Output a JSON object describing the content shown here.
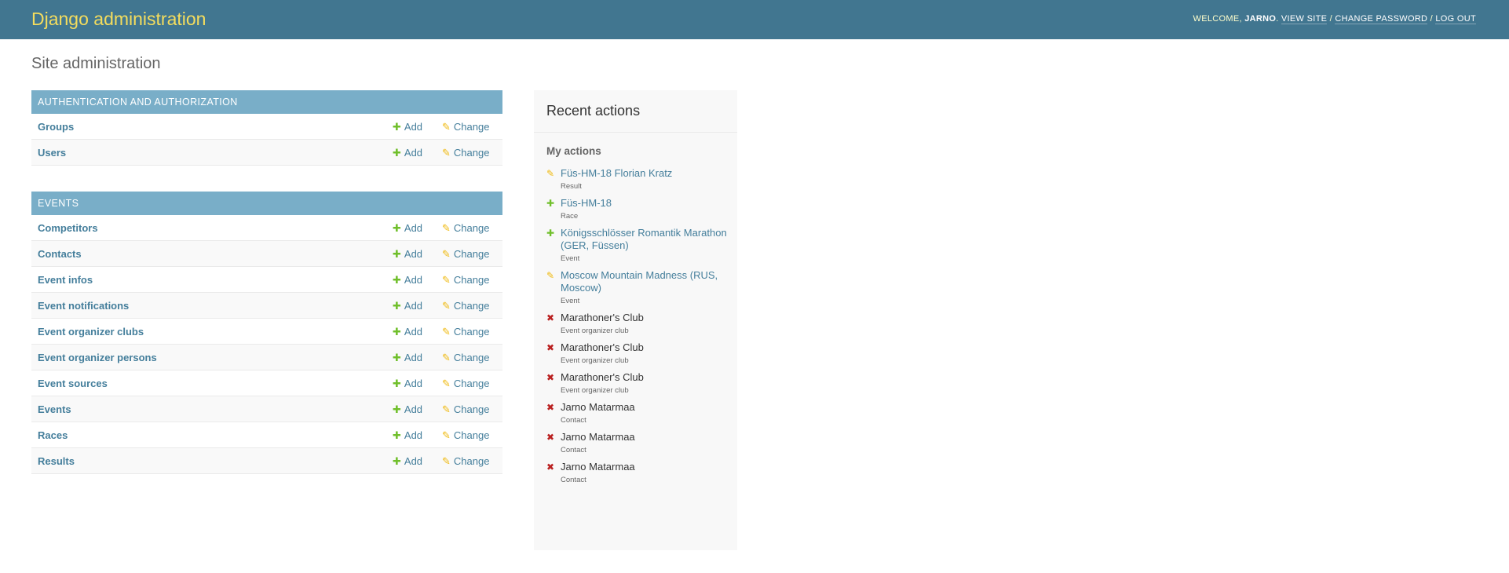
{
  "header": {
    "branding": "Django administration",
    "welcome": "Welcome, ",
    "username": "Jarno",
    "period": ". ",
    "view_site": "View site",
    "sep": " / ",
    "change_password": "Change password",
    "log_out": "Log out"
  },
  "page_title": "Site administration",
  "modules": [
    {
      "caption": "Authentication and Authorization",
      "models": [
        "Groups",
        "Users"
      ]
    },
    {
      "caption": "Events",
      "models": [
        "Competitors",
        "Contacts",
        "Event infos",
        "Event notifications",
        "Event organizer clubs",
        "Event organizer persons",
        "Event sources",
        "Events",
        "Races",
        "Results"
      ]
    }
  ],
  "actions": {
    "add": "Add",
    "change": "Change"
  },
  "recent": {
    "title": "Recent actions",
    "my_actions": "My actions",
    "items": [
      {
        "icon": "change",
        "label": "Füs-HM-18 Florian Kratz",
        "type": "Result"
      },
      {
        "icon": "add",
        "label": "Füs-HM-18",
        "type": "Race"
      },
      {
        "icon": "add",
        "label": "Königsschlösser Romantik Marathon (GER, Füssen)",
        "type": "Event"
      },
      {
        "icon": "change",
        "label": "Moscow Mountain Madness (RUS, Moscow)",
        "type": "Event"
      },
      {
        "icon": "delete",
        "label": "Marathoner's Club",
        "type": "Event organizer club"
      },
      {
        "icon": "delete",
        "label": "Marathoner's Club",
        "type": "Event organizer club"
      },
      {
        "icon": "delete",
        "label": "Marathoner's Club",
        "type": "Event organizer club"
      },
      {
        "icon": "delete",
        "label": "Jarno Matarmaa",
        "type": "Contact"
      },
      {
        "icon": "delete",
        "label": "Jarno Matarmaa",
        "type": "Contact"
      },
      {
        "icon": "delete",
        "label": "Jarno Matarmaa",
        "type": "Contact"
      }
    ]
  },
  "colors": {
    "header_bg": "#417690",
    "branding": "#f5dd5d",
    "module_caption": "#79aec8",
    "link": "#447e9b",
    "add": "#70bf2b",
    "change": "#efb80b",
    "delete": "#ba2121"
  }
}
